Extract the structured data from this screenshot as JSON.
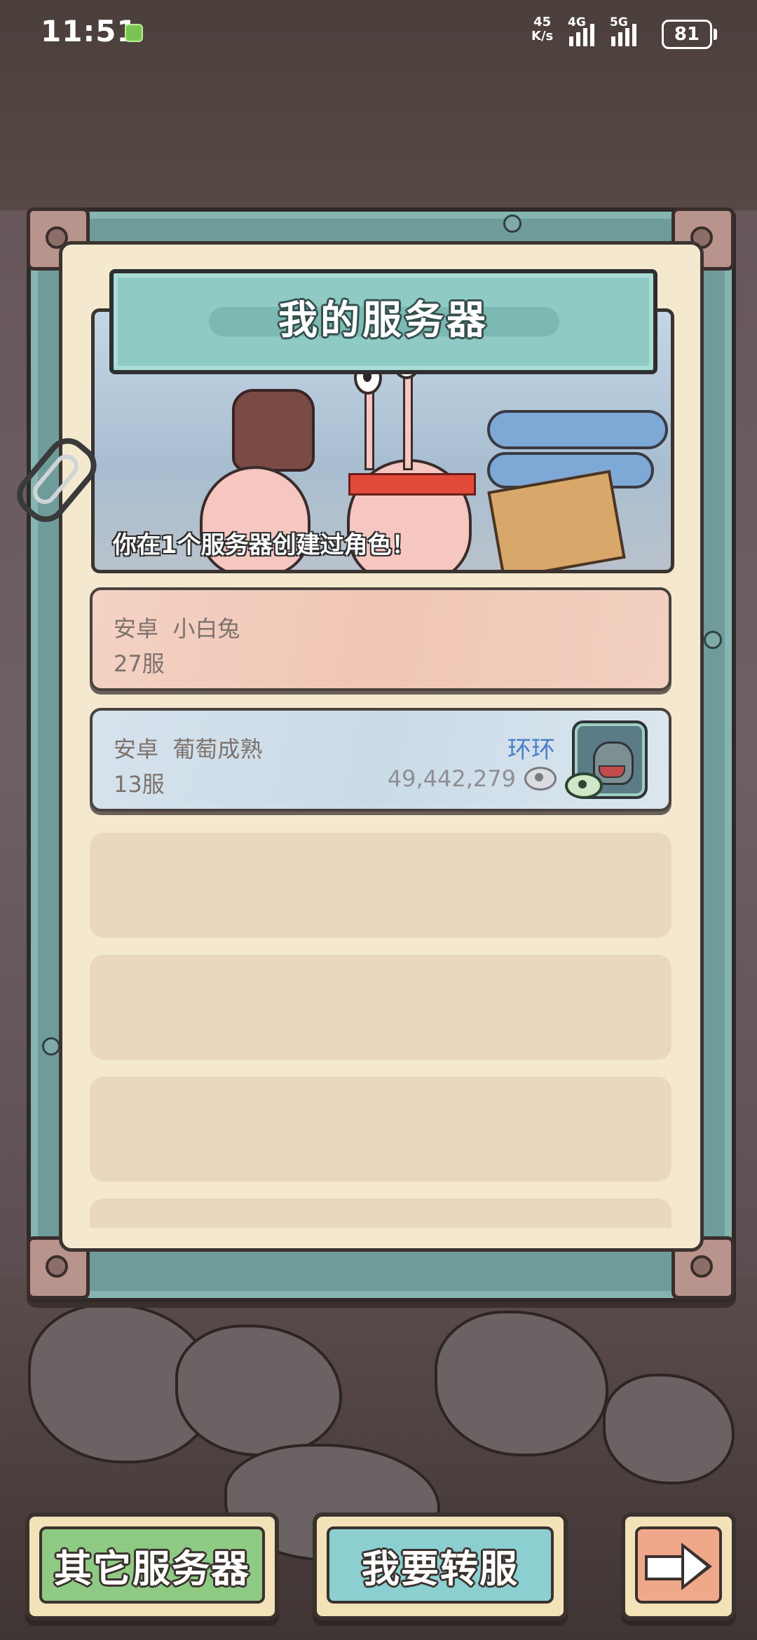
{
  "status_bar": {
    "time": "11:51",
    "net_speed_top": "45",
    "net_speed_unit": "K/s",
    "signal_1": "4G",
    "signal_2": "5G",
    "battery": "81"
  },
  "panel": {
    "title": "我的服务器",
    "caption": "你在1个服务器创建过角色！"
  },
  "servers": [
    {
      "platform": "安卓",
      "name": "小白兔",
      "number": "27服"
    },
    {
      "platform": "安卓",
      "name": "葡萄成熟",
      "number": "13服",
      "character": "环环",
      "power": "49,442,279"
    }
  ],
  "buttons": {
    "other_servers": "其它服务器",
    "transfer": "我要转服",
    "next_icon": "arrow-right-icon"
  },
  "colors": {
    "accent_teal": "#8fcac4",
    "row_pink": "#f0c6b4",
    "row_blue": "#cadbe8",
    "character_name": "#4b7fc8",
    "btn_green": "#8fca84",
    "btn_teal": "#8ccfd0",
    "btn_orange": "#f0a88a"
  }
}
